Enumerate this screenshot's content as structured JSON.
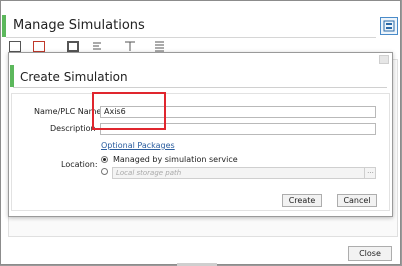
{
  "outer": {
    "title": "Manage Simulations",
    "close_label": "Close"
  },
  "dialog": {
    "title": "Create Simulation",
    "name_label": "Name/PLC Name",
    "name_value": "Axis6",
    "description_label": "Description",
    "description_value": "",
    "optional_packages_link": "Optional Packages",
    "location_label": "Location:",
    "location_option_managed": "Managed by simulation service",
    "location_option_local_placeholder": "Local storage path",
    "browse_label": "...",
    "create_label": "Create",
    "cancel_label": "Cancel"
  },
  "colors": {
    "accent": "#5cb85c",
    "link": "#2a5d9f",
    "highlight": "#e0262e"
  },
  "icons": [
    "manage-simulations-icon",
    "new-icon",
    "delete-icon",
    "monitor-icon",
    "tree-icon",
    "filter-icon",
    "list-icon",
    "dialog-close-icon"
  ]
}
